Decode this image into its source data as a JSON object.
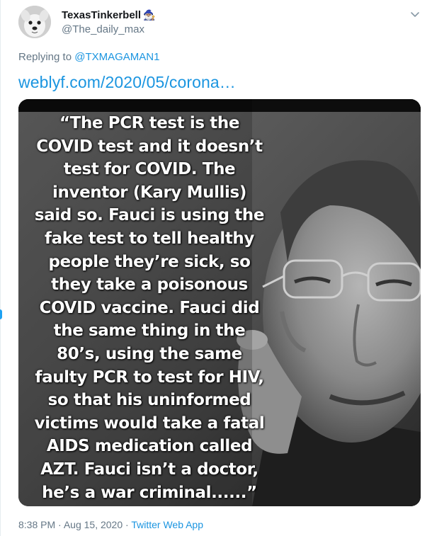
{
  "tweet": {
    "author_name": "TexasTinkerbell",
    "author_emoji": "🧙🏽‍♂️",
    "author_handle": "@The_daily_max",
    "reply_prefix": "Replying to",
    "reply_to": "@TXMAGAMAN1",
    "link_text": "weblyf.com/2020/05/corona…",
    "media": {
      "quote_lines": [
        "“The PCR test is the",
        "COVID test and it doesn’t",
        "test for COVID. The",
        "inventor (Kary Mullis)",
        "said so. Fauci is using the",
        "fake test to tell healthy",
        "people they’re sick, so",
        "they take a poisonous",
        "COVID vaccine. Fauci did",
        "the same thing in the",
        "80’s, using the same",
        "faulty PCR to test for HIV,",
        "so that his uninformed",
        "victims would take a fatal",
        "AIDS medication called",
        "AZT. Fauci isn’t a doctor,",
        "he’s a war criminal......”"
      ]
    },
    "time": "8:38 PM",
    "separator": "·",
    "date": "Aug 15, 2020",
    "source_app": "Twitter Web App"
  },
  "icons": {
    "avatar": "dog-avatar",
    "more": "chevron-down-icon"
  },
  "colors": {
    "link": "#1b95e0",
    "secondary_text": "#657786",
    "name_text": "#14171a"
  }
}
